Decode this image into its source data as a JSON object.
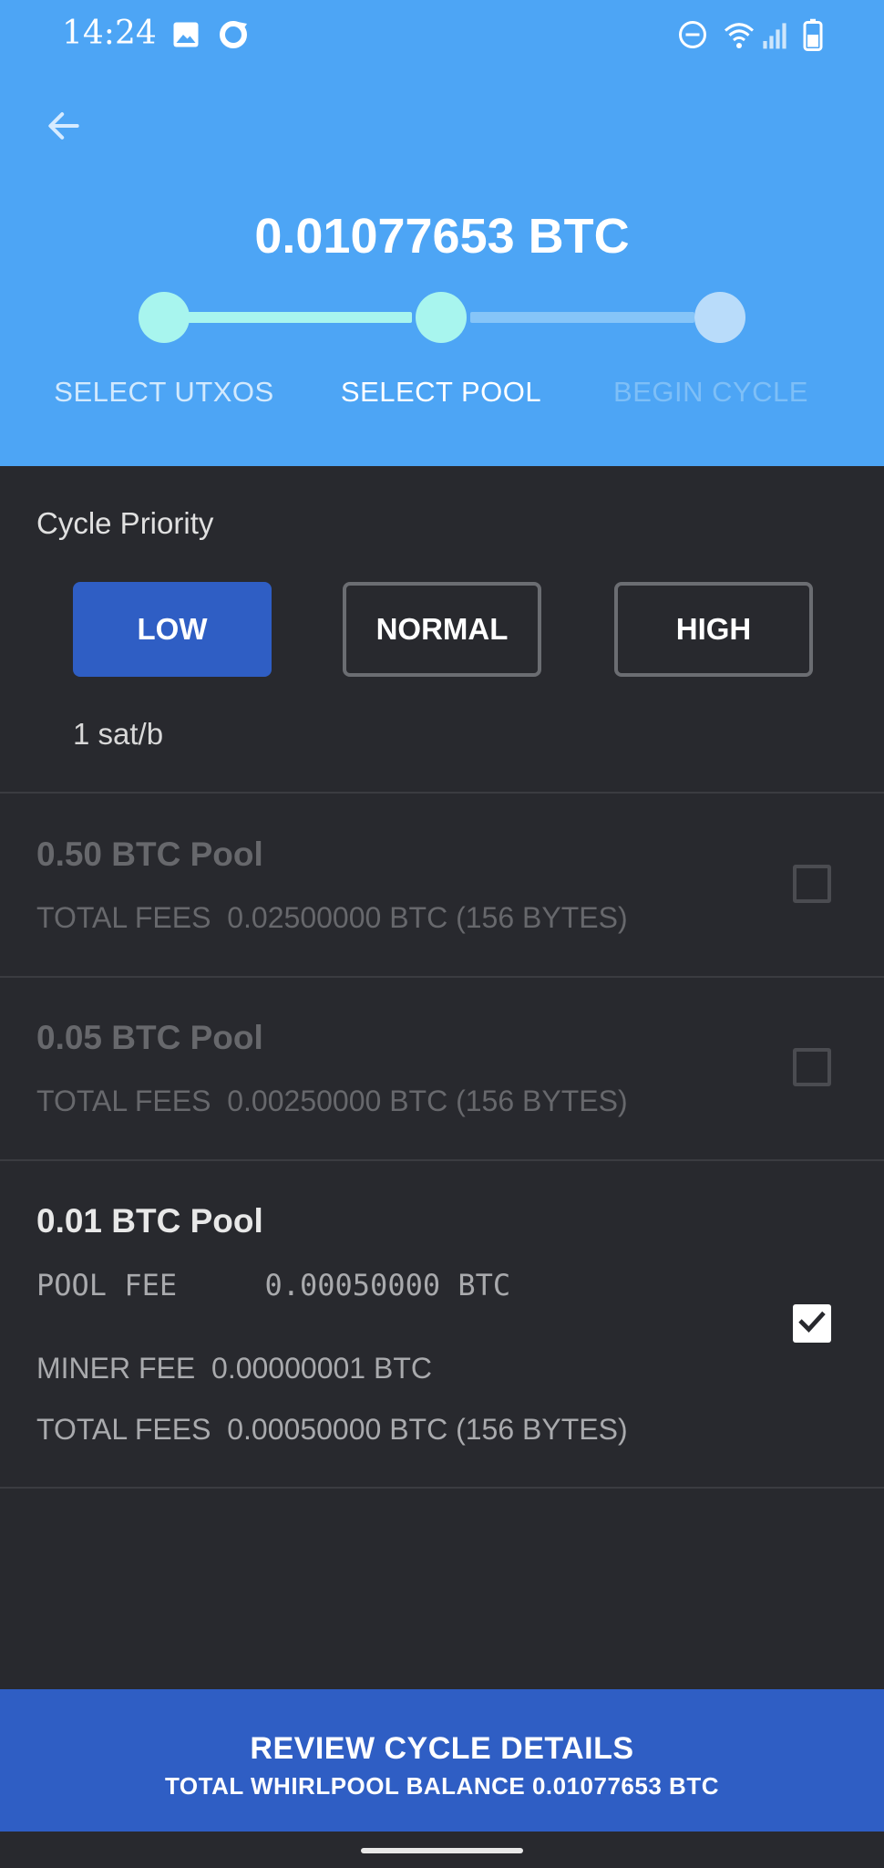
{
  "status_bar": {
    "time": "14:24",
    "left_icons": [
      "image-icon",
      "sync-icon"
    ],
    "right_icons": [
      "do-not-disturb-icon",
      "wifi-icon",
      "signal-icon",
      "battery-icon"
    ]
  },
  "header": {
    "back_icon": "arrow-left-icon",
    "amount": "0.01077653 BTC",
    "steps": [
      {
        "label": "SELECT UTXOS",
        "state": "done"
      },
      {
        "label": "SELECT POOL",
        "state": "active"
      },
      {
        "label": "BEGIN CYCLE",
        "state": "pending"
      }
    ]
  },
  "priority": {
    "title": "Cycle Priority",
    "options": [
      {
        "label": "LOW",
        "selected": true
      },
      {
        "label": "NORMAL",
        "selected": false
      },
      {
        "label": "HIGH",
        "selected": false
      }
    ],
    "fee_rate": "1 sat/b"
  },
  "pools": [
    {
      "title": "0.50 BTC Pool",
      "total_fees": "TOTAL FEES  0.02500000 BTC (156 BYTES)",
      "checked": false
    },
    {
      "title": "0.05 BTC Pool",
      "total_fees": "TOTAL FEES  0.00250000 BTC (156 BYTES)",
      "checked": false
    },
    {
      "title": "0.01 BTC Pool",
      "pool_fee": "POOL FEE     0.00050000 BTC",
      "miner_fee": "MINER FEE  0.00000001 BTC",
      "total_fees": "TOTAL FEES  0.00050000 BTC (156 BYTES)",
      "checked": true
    }
  ],
  "review": {
    "title": "REVIEW CYCLE DETAILS",
    "subtitle": "TOTAL WHIRLPOOL BALANCE 0.01077653 BTC"
  },
  "colors": {
    "header_bg": "#4da5f5",
    "body_bg": "#28292e",
    "accent": "#2f5ec4",
    "step_active": "#a8f5ee",
    "step_pending": "#b9dcfa"
  }
}
